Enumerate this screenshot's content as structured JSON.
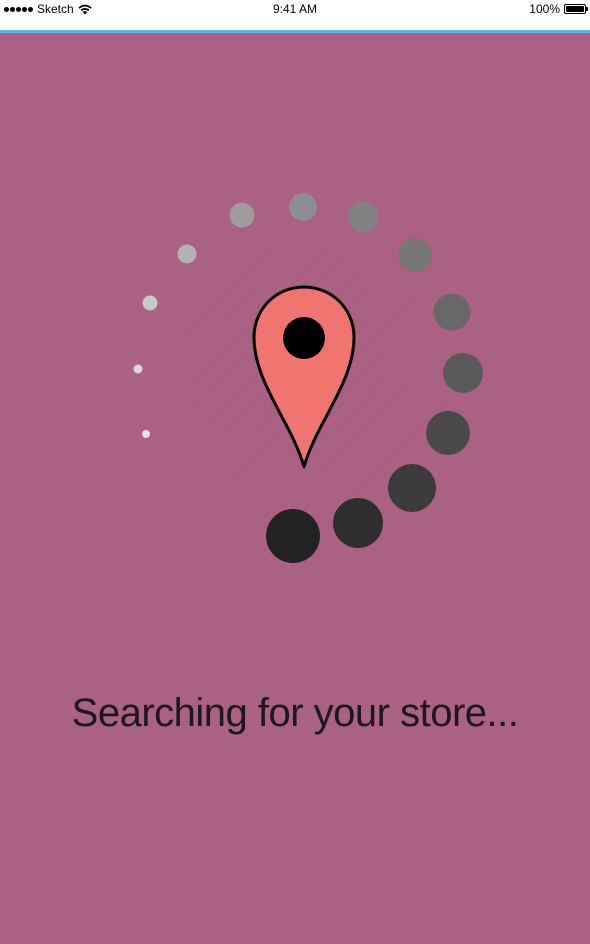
{
  "status_bar": {
    "carrier": "Sketch",
    "time": "9:41 AM",
    "battery": "100%",
    "signal_icon": "signal-dots-icon",
    "wifi_icon": "wifi-icon",
    "battery_icon": "battery-icon"
  },
  "colors": {
    "background": "#aa6184",
    "pin_fill": "#f07570",
    "accent_line": "#5cb8e6",
    "text": "#1a1a1a"
  },
  "loader": {
    "pin_icon": "location-pin-icon",
    "spinner_icon": "loading-spinner-icon"
  },
  "message": "Searching for your store..."
}
